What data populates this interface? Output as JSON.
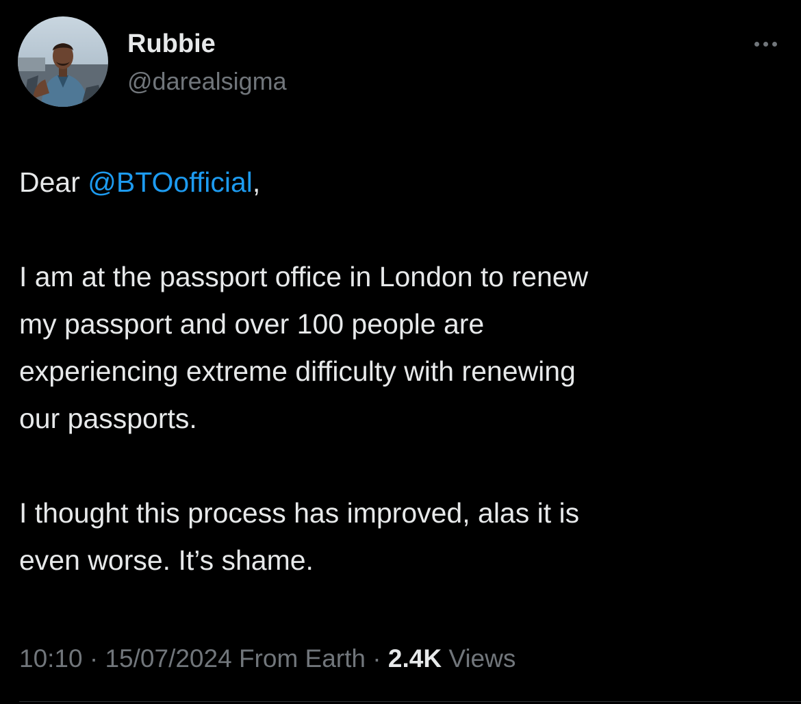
{
  "author": {
    "name": "Rubbie",
    "handle": "@darealsigma",
    "avatar_icon": "profile-photo"
  },
  "more_icon": "ellipsis-icon",
  "tweet": {
    "greeting_prefix": "Dear ",
    "mention": "@BTOofficial",
    "greeting_suffix": ",",
    "paragraph_2_lines": [
      "I am at the passport office in London to renew",
      "my passport and over 100 people are",
      "experiencing extreme difficulty with renewing",
      "our passports."
    ],
    "paragraph_3_lines": [
      "I thought this process has improved, alas it is",
      "even worse. It’s shame."
    ]
  },
  "meta": {
    "time": "10:10",
    "separator": " · ",
    "date": "15/07/2024",
    "source": "From Earth",
    "views_count": "2.4K",
    "views_label": "Views"
  },
  "colors": {
    "background": "#000000",
    "text_primary": "#e7e9ea",
    "text_secondary": "#71767b",
    "link": "#1d9bf0"
  }
}
